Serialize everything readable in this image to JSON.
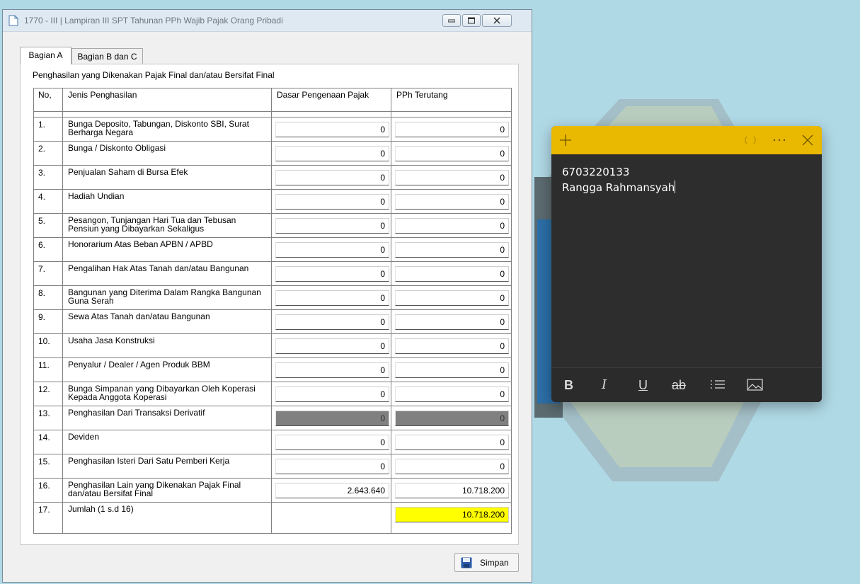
{
  "window": {
    "title": "1770 - III | Lampiran III SPT Tahunan PPh Wajib Pajak Orang Pribadi"
  },
  "tabs": [
    {
      "label": "Bagian A",
      "active": true
    },
    {
      "label": "Bagian B dan C",
      "active": false
    }
  ],
  "section_title": "Penghasilan yang Dikenakan Pajak Final dan/atau Bersifat Final",
  "table": {
    "headers": {
      "no": "No,",
      "jenis": "Jenis Penghasilan",
      "dasar": "Dasar Pengenaan Pajak",
      "pph": "PPh Terutang"
    },
    "rows": [
      {
        "no": "1.",
        "jenis": "Bunga Deposito, Tabungan, Diskonto SBI, Surat Berharga Negara",
        "dasar": "0",
        "pph": "0"
      },
      {
        "no": "2.",
        "jenis": "Bunga / Diskonto Obligasi",
        "dasar": "0",
        "pph": "0"
      },
      {
        "no": "3.",
        "jenis": "Penjualan Saham di Bursa Efek",
        "dasar": "0",
        "pph": "0"
      },
      {
        "no": "4.",
        "jenis": "Hadiah Undian",
        "dasar": "0",
        "pph": "0"
      },
      {
        "no": "5.",
        "jenis": "Pesangon, Tunjangan Hari Tua dan Tebusan Pensiun yang Dibayarkan Sekaligus",
        "dasar": "0",
        "pph": "0"
      },
      {
        "no": "6.",
        "jenis": "Honorarium Atas Beban APBN / APBD",
        "dasar": "0",
        "pph": "0"
      },
      {
        "no": "7.",
        "jenis": "Pengalihan Hak Atas Tanah dan/atau Bangunan",
        "dasar": "0",
        "pph": "0"
      },
      {
        "no": "8.",
        "jenis": "Bangunan yang Diterima Dalam Rangka Bangunan Guna Serah",
        "dasar": "0",
        "pph": "0"
      },
      {
        "no": "9.",
        "jenis": "Sewa Atas Tanah dan/atau Bangunan",
        "dasar": "0",
        "pph": "0"
      },
      {
        "no": "10.",
        "jenis": "Usaha Jasa Konstruksi",
        "dasar": "0",
        "pph": "0"
      },
      {
        "no": "11.",
        "jenis": "Penyalur / Dealer / Agen Produk BBM",
        "dasar": "0",
        "pph": "0"
      },
      {
        "no": "12.",
        "jenis": "Bunga Simpanan yang Dibayarkan Oleh Koperasi Kepada Anggota Koperasi",
        "dasar": "0",
        "pph": "0"
      },
      {
        "no": "13.",
        "jenis": "Penghasilan Dari Transaksi Derivatif",
        "dasar": "0",
        "pph": "0"
      },
      {
        "no": "14.",
        "jenis": "Deviden",
        "dasar": "0",
        "pph": "0"
      },
      {
        "no": "15.",
        "jenis": "Penghasilan Isteri Dari Satu Pemberi Kerja",
        "dasar": "0",
        "pph": "0"
      },
      {
        "no": "16.",
        "jenis": "Penghasilan Lain yang Dikenakan Pajak Final dan/atau Bersifat Final",
        "dasar": "2.643.640",
        "pph": "10.718.200"
      },
      {
        "no": "17.",
        "jenis": "Jumlah (1 s.d 16)",
        "dasar": "",
        "pph": "10.718.200"
      }
    ]
  },
  "save_button": {
    "label": "Simpan"
  },
  "sticky_note": {
    "line1": "6703220133",
    "line2": "Rangga Rahmansyah",
    "format_buttons": {
      "bold": "B",
      "italic": "I",
      "underline": "U",
      "strikethrough": "ab"
    }
  },
  "colors": {
    "note_header": "#e9b800",
    "note_body": "#2d2d2d",
    "total_highlight": "#ffff00",
    "disabled_field": "#808080"
  }
}
